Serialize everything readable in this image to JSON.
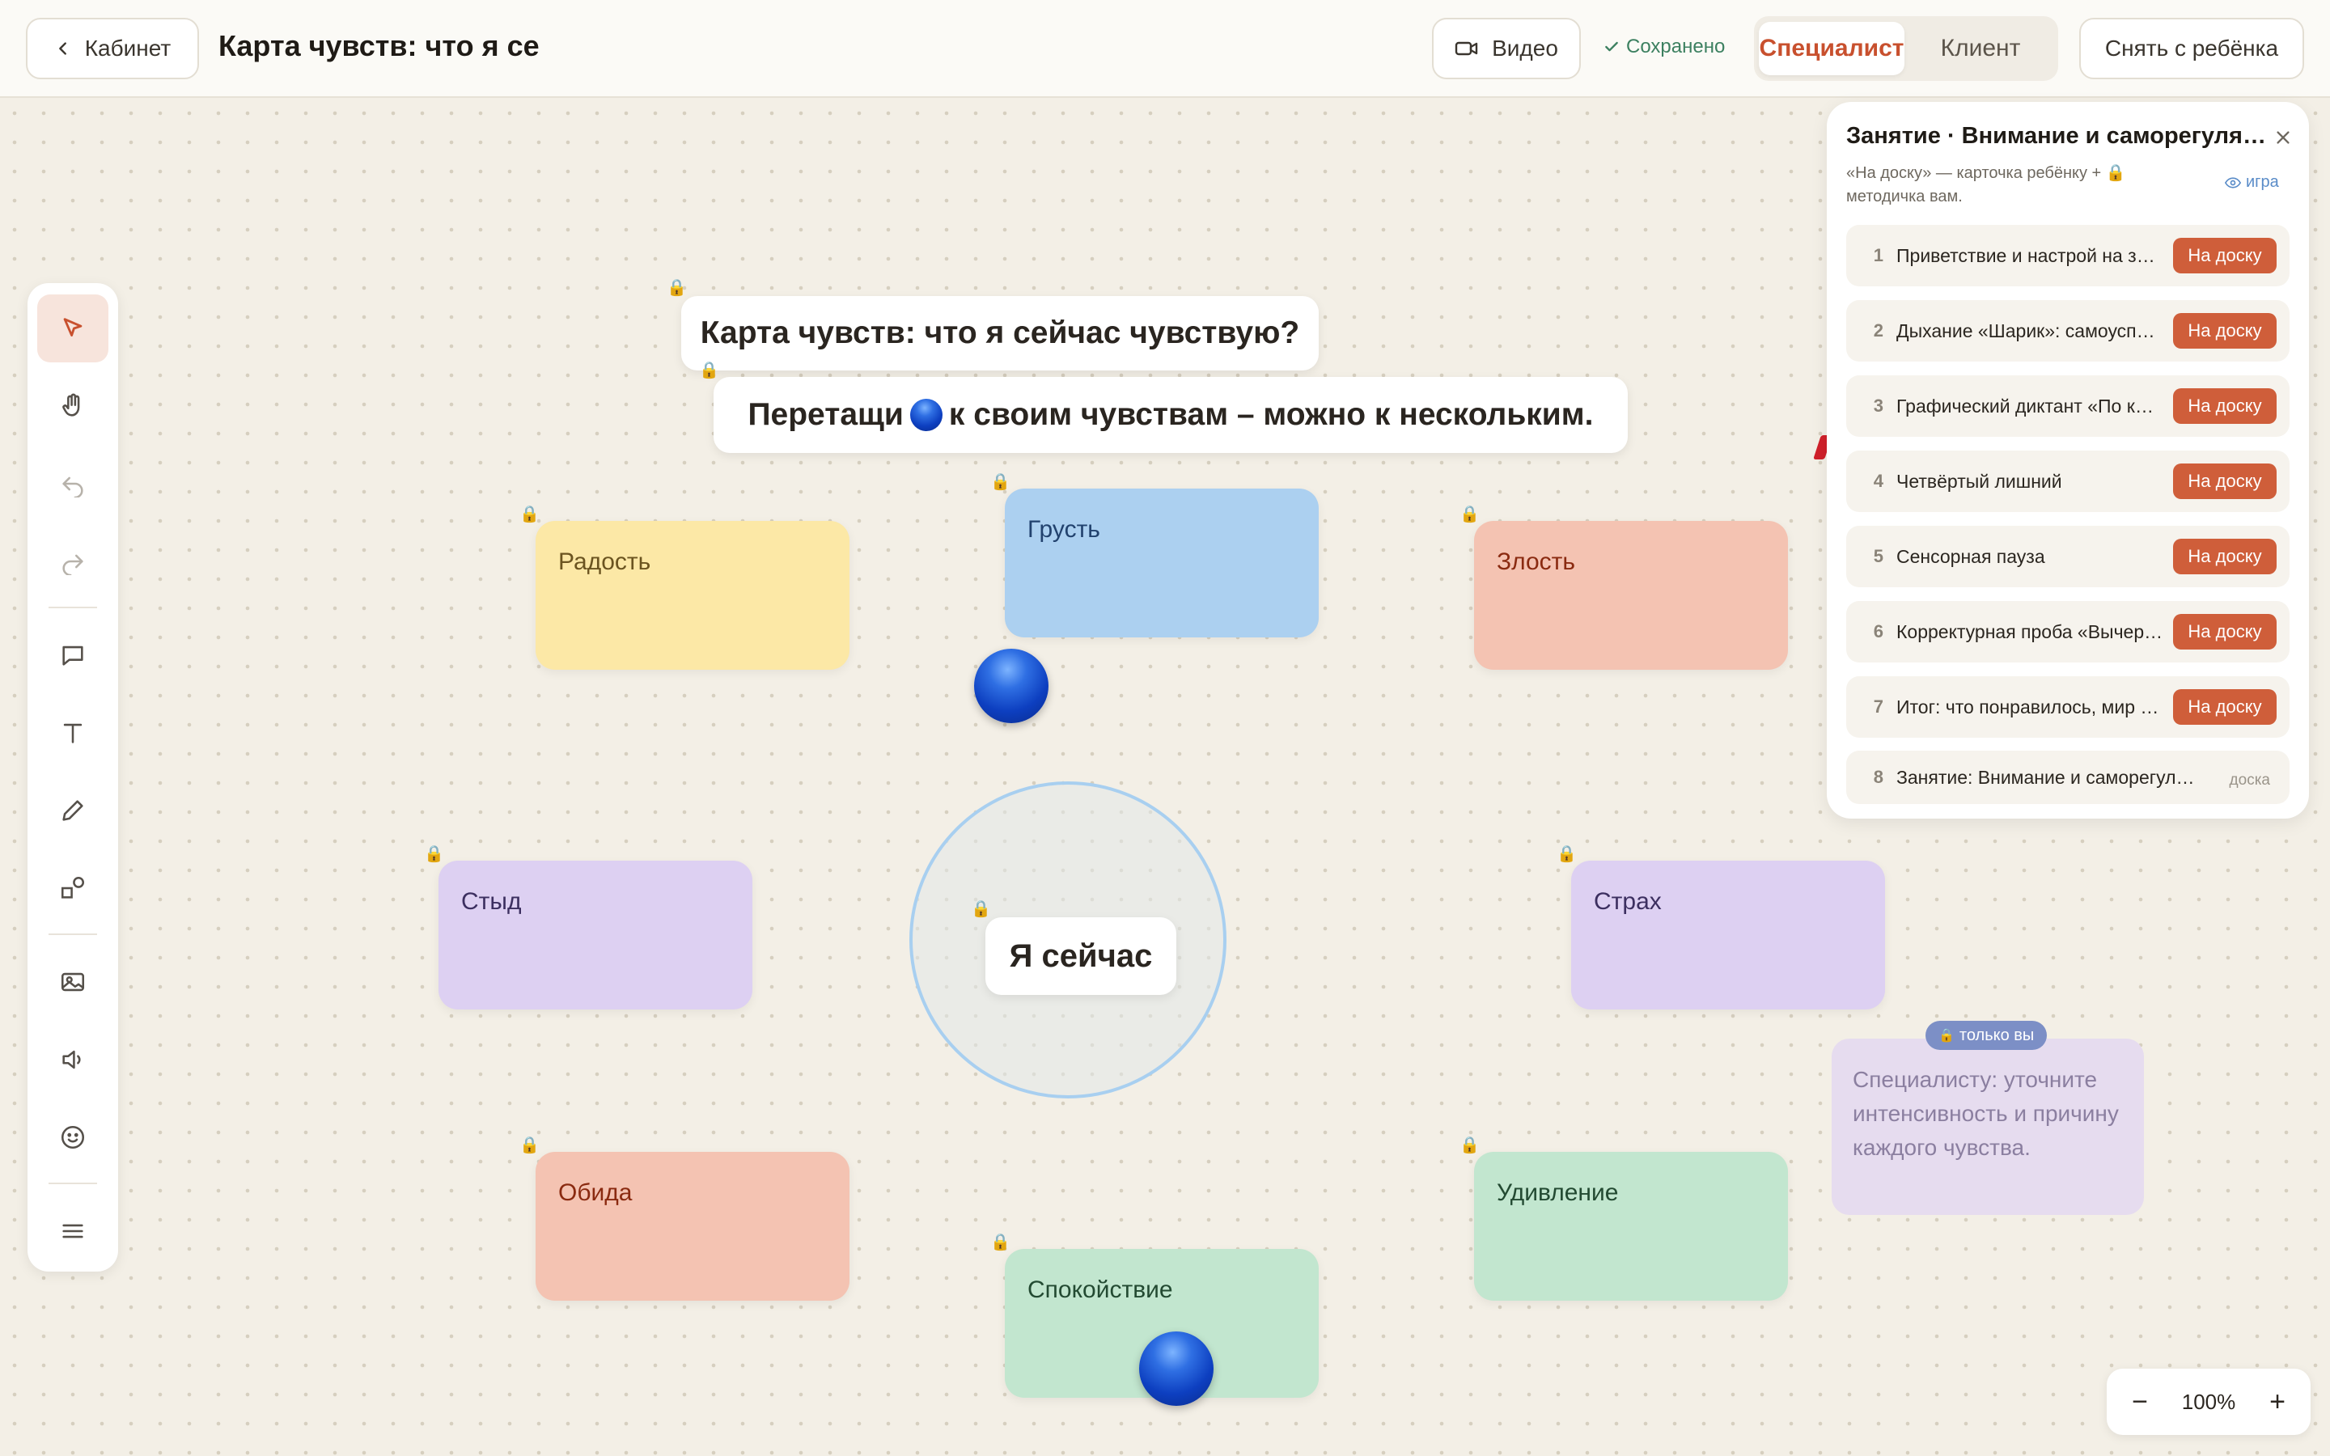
{
  "topbar": {
    "back_label": "Кабинет",
    "doc_title": "Карта чувств: что я сейчас чувствую?",
    "video_label": "Видео",
    "saved_label": "Сохранено",
    "roles": [
      {
        "label": "Специалист",
        "active": true
      },
      {
        "label": "Клиент",
        "active": false
      }
    ],
    "remove_label": "Снять с ребёнка"
  },
  "board": {
    "title_text": "Карта чувств: что я сейчас чувствую?",
    "instruction_before": "Перетащи",
    "instruction_after": "к своим чувствам – можно к нескольким.",
    "center_label": "Я сейчас",
    "emotions": [
      {
        "label": "Радость",
        "color": "#fce8a6",
        "text_color": "#6b5420"
      },
      {
        "label": "Грусть",
        "color": "#acd0f0",
        "text_color": "#22426e"
      },
      {
        "label": "Злость",
        "color": "#f4c3b2",
        "text_color": "#8a2a10"
      },
      {
        "label": "Стыд",
        "color": "#ddd0f2",
        "text_color": "#3c2f60"
      },
      {
        "label": "Страх",
        "color": "#ddd0f2",
        "text_color": "#3c2f60"
      },
      {
        "label": "Обида",
        "color": "#f4c3b2",
        "text_color": "#8a2a10"
      },
      {
        "label": "Удивление",
        "color": "#c2e6cf",
        "text_color": "#234a32"
      },
      {
        "label": "Спокойствие",
        "color": "#c2e6cf",
        "text_color": "#234a32"
      }
    ],
    "note_badge": "только вы",
    "note_text": "Специалисту: уточните интенсивность и причину каждого чувства."
  },
  "panel": {
    "title": "Занятие · Внимание и саморегуляция",
    "subtitle": "«На доску» — карточка ребёнку + 🔒 методичка вам.",
    "game_label": "игра",
    "board_button": "На доску",
    "steps": [
      {
        "num": "1",
        "label": "Приветствие и настрой на занятие",
        "action": "button"
      },
      {
        "num": "2",
        "label": "Дыхание «Шарик»: самоуспокоение",
        "action": "button"
      },
      {
        "num": "3",
        "label": "Графический диктант «По клеточкам»",
        "action": "button"
      },
      {
        "num": "4",
        "label": "Четвёртый лишний",
        "action": "button"
      },
      {
        "num": "5",
        "label": "Сенсорная пауза",
        "action": "button"
      },
      {
        "num": "6",
        "label": "Корректурная проба «Вычеркни»",
        "action": "button"
      },
      {
        "num": "7",
        "label": "Итог: что понравилось, мир настроения",
        "action": "button"
      },
      {
        "num": "8",
        "label": "Занятие: Внимание и саморегуляция",
        "tag": "доска"
      }
    ]
  },
  "zoom": {
    "minus": "−",
    "value": "100%",
    "plus": "+"
  },
  "tools": [
    "select-tool",
    "hand-tool",
    "undo",
    "redo",
    "comment-tool",
    "text-tool",
    "pen-tool",
    "shapes-tool",
    "image-tool",
    "audio-tool",
    "emoji-tool",
    "menu"
  ]
}
